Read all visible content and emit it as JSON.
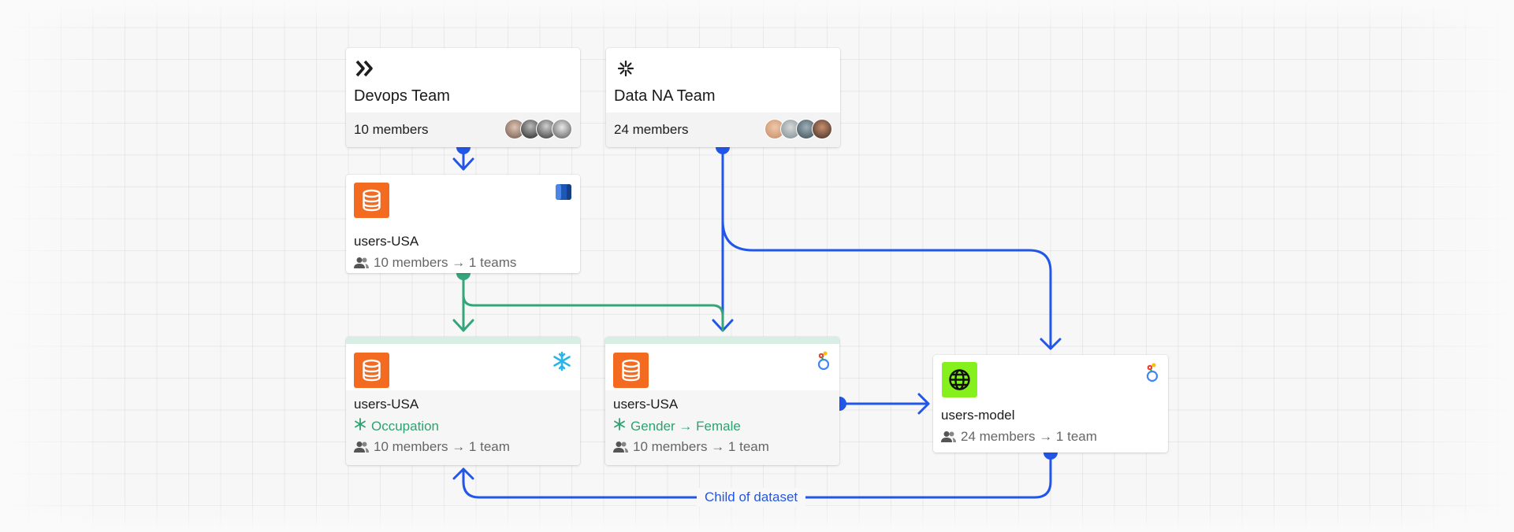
{
  "colors": {
    "blue_edge": "#2256e8",
    "green_edge": "#35a57a",
    "db_orange": "#f26b21",
    "globe_green": "#86f01e",
    "tag_green": "#2fa170"
  },
  "teams": [
    {
      "icon": "chevrons-icon",
      "title": "Devops Team",
      "members": "10 members"
    },
    {
      "icon": "asterisk-icon",
      "title": "Data NA Team",
      "members": "24 members"
    }
  ],
  "datasets": [
    {
      "icon": "database-icon",
      "source_icon": "aws-s3-icon",
      "title": "users-USA",
      "stats": "10 members → 1 teams"
    },
    {
      "icon": "database-icon",
      "source_icon": "snowflake-icon",
      "title": "users-USA",
      "tag": "Occupation",
      "stats": "10 members → 1 team"
    },
    {
      "icon": "database-icon",
      "source_icon": "looker-icon",
      "title": "users-USA",
      "tag": "Gender → Female",
      "stats": "10 members → 1 team"
    }
  ],
  "model": {
    "icon": "globe-icon",
    "source_icon": "looker-icon",
    "title": "users-model",
    "stats": "24 members → 1 team"
  },
  "edge_label": "Child of dataset"
}
